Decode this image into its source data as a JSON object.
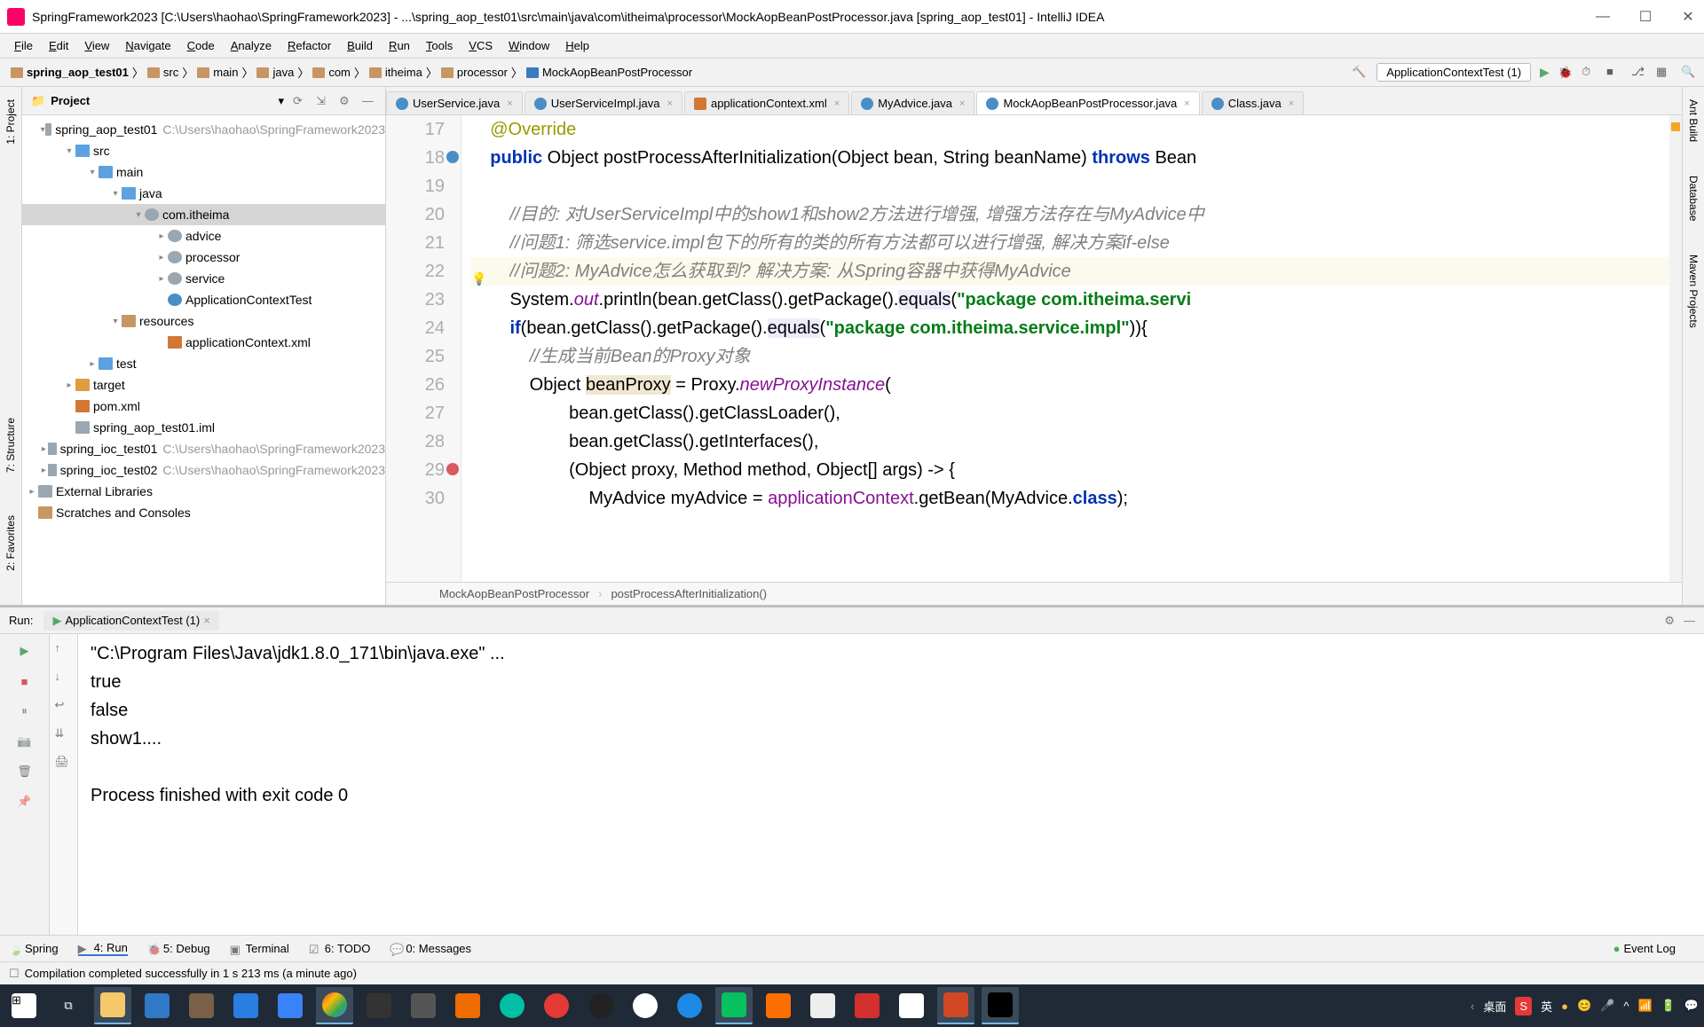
{
  "title": "SpringFramework2023 [C:\\Users\\haohao\\SpringFramework2023] - ...\\spring_aop_test01\\src\\main\\java\\com\\itheima\\processor\\MockAopBeanPostProcessor.java [spring_aop_test01] - IntelliJ IDEA",
  "menu": [
    "File",
    "Edit",
    "View",
    "Navigate",
    "Code",
    "Analyze",
    "Refactor",
    "Build",
    "Run",
    "Tools",
    "VCS",
    "Window",
    "Help"
  ],
  "breadcrumbs": [
    "spring_aop_test01",
    "src",
    "main",
    "java",
    "com",
    "itheima",
    "processor",
    "MockAopBeanPostProcessor"
  ],
  "run_config": "ApplicationContextTest (1)",
  "project": {
    "header": "Project",
    "tree": [
      {
        "ind": 20,
        "tw": "▾",
        "ic": "mod",
        "label": "spring_aop_test01",
        "gray": "C:\\Users\\haohao\\SpringFramework2023"
      },
      {
        "ind": 46,
        "tw": "▾",
        "ic": "src",
        "label": "src"
      },
      {
        "ind": 72,
        "tw": "▾",
        "ic": "src",
        "label": "main"
      },
      {
        "ind": 98,
        "tw": "▾",
        "ic": "src",
        "label": "java"
      },
      {
        "ind": 124,
        "tw": "▾",
        "ic": "pkg",
        "label": "com.itheima",
        "sel": true
      },
      {
        "ind": 150,
        "tw": "▸",
        "ic": "pkg",
        "label": "advice"
      },
      {
        "ind": 150,
        "tw": "▸",
        "ic": "pkg",
        "label": "processor"
      },
      {
        "ind": 150,
        "tw": "▸",
        "ic": "pkg",
        "label": "service"
      },
      {
        "ind": 150,
        "tw": "",
        "ic": "jav",
        "label": "ApplicationContextTest"
      },
      {
        "ind": 98,
        "tw": "▾",
        "ic": "fld",
        "label": "resources"
      },
      {
        "ind": 150,
        "tw": "",
        "ic": "xml",
        "label": "applicationContext.xml"
      },
      {
        "ind": 72,
        "tw": "▸",
        "ic": "src",
        "label": "test"
      },
      {
        "ind": 46,
        "tw": "▸",
        "ic": "tgt",
        "label": "target"
      },
      {
        "ind": 46,
        "tw": "",
        "ic": "xml",
        "label": "pom.xml"
      },
      {
        "ind": 46,
        "tw": "",
        "ic": "mod",
        "label": "spring_aop_test01.iml"
      },
      {
        "ind": 20,
        "tw": "▸",
        "ic": "mod",
        "label": "spring_ioc_test01",
        "gray": "C:\\Users\\haohao\\SpringFramework2023"
      },
      {
        "ind": 20,
        "tw": "▸",
        "ic": "mod",
        "label": "spring_ioc_test02",
        "gray": "C:\\Users\\haohao\\SpringFramework2023"
      },
      {
        "ind": 4,
        "tw": "▸",
        "ic": "mod",
        "label": "External Libraries"
      },
      {
        "ind": 4,
        "tw": "",
        "ic": "fld",
        "label": "Scratches and Consoles"
      }
    ]
  },
  "tabs": [
    {
      "label": "UserService.java",
      "ic": "ti"
    },
    {
      "label": "UserServiceImpl.java",
      "ic": "ti"
    },
    {
      "label": "applicationContext.xml",
      "ic": "x"
    },
    {
      "label": "MyAdvice.java",
      "ic": "ti"
    },
    {
      "label": "MockAopBeanPostProcessor.java",
      "ic": "ti",
      "act": true
    },
    {
      "label": "Class.java",
      "ic": "ti"
    }
  ],
  "code": {
    "first_line": 17,
    "lines": [
      {
        "n": 17,
        "h": "    <span class='ann'>@Override</span>"
      },
      {
        "n": 18,
        "h": "    <span class='kw'>public</span> Object postProcessAfterInitialization(Object bean, String beanName) <span class='kw'>throws</span> Bean",
        "marker": "o"
      },
      {
        "n": 19,
        "h": ""
      },
      {
        "n": 20,
        "h": "        <span class='cmt'>//目的: 对UserServiceImpl中的show1和show2方法进行增强, 增强方法存在与MyAdvice中</span>"
      },
      {
        "n": 21,
        "h": "        <span class='cmt'>//问题1: 筛选service.impl包下的所有的类的所有方法都可以进行增强, 解决方案if-else</span>"
      },
      {
        "n": 22,
        "h": "        <span class='cmt'>//问题2: MyAdvice怎么获取到? 解决方案: 从Spring容器中获得MyAdvice</span>",
        "hl": true,
        "bulb": true
      },
      {
        "n": 23,
        "h": "        System.<span class='stat'>out</span>.println(bean.getClass().getPackage().<span class='hlw'>equals</span>(<span class='str'>\"package com.itheima.servi</span>"
      },
      {
        "n": 24,
        "h": "        <span class='kw'>if</span>(bean.getClass().getPackage().<span class='hlw'>equals</span>(<span class='str'>\"package com.itheima.service.impl\"</span>)){"
      },
      {
        "n": 25,
        "h": "            <span class='cmt'>//生成当前Bean的Proxy对象</span>"
      },
      {
        "n": 26,
        "h": "            Object <span class='hl'>beanProxy</span> = Proxy.<span class='stat'>newProxyInstance</span>("
      },
      {
        "n": 27,
        "h": "                    bean.getClass().getClassLoader(),"
      },
      {
        "n": 28,
        "h": "                    bean.getClass().getInterfaces(),"
      },
      {
        "n": 29,
        "h": "                    (Object proxy, Method method, Object[] args) -> {",
        "marker": "r"
      },
      {
        "n": 30,
        "h": "                        MyAdvice myAdvice = <span class='fld'>applicationContext</span>.getBean(MyAdvice.<span class='kw'>class</span>);"
      }
    ]
  },
  "crumb2": [
    "MockAopBeanPostProcessor",
    "postProcessAfterInitialization()"
  ],
  "run": {
    "label": "Run:",
    "tab": "ApplicationContextTest (1)",
    "out": [
      "\"C:\\Program Files\\Java\\jdk1.8.0_171\\bin\\java.exe\" ...",
      "true",
      "false",
      "show1....",
      "",
      "Process finished with exit code 0"
    ]
  },
  "bottom_tabs": [
    {
      "ic": "🍃",
      "label": "Spring"
    },
    {
      "ic": "▶",
      "label": "4: Run",
      "act": true
    },
    {
      "ic": "🐞",
      "label": "5: Debug"
    },
    {
      "ic": "▣",
      "label": "Terminal"
    },
    {
      "ic": "☑",
      "label": "6: TODO"
    },
    {
      "ic": "💬",
      "label": "0: Messages"
    }
  ],
  "event_log": "Event Log",
  "status": "Compilation completed successfully in 1 s 213 ms (a minute ago)",
  "left_tabs": [
    "1: Project",
    "7: Structure",
    "2: Favorites"
  ],
  "right_tabs": [
    "Ant Build",
    "Database",
    "Maven Projects"
  ],
  "tray": {
    "desk": "桌面",
    "lang": "英"
  }
}
